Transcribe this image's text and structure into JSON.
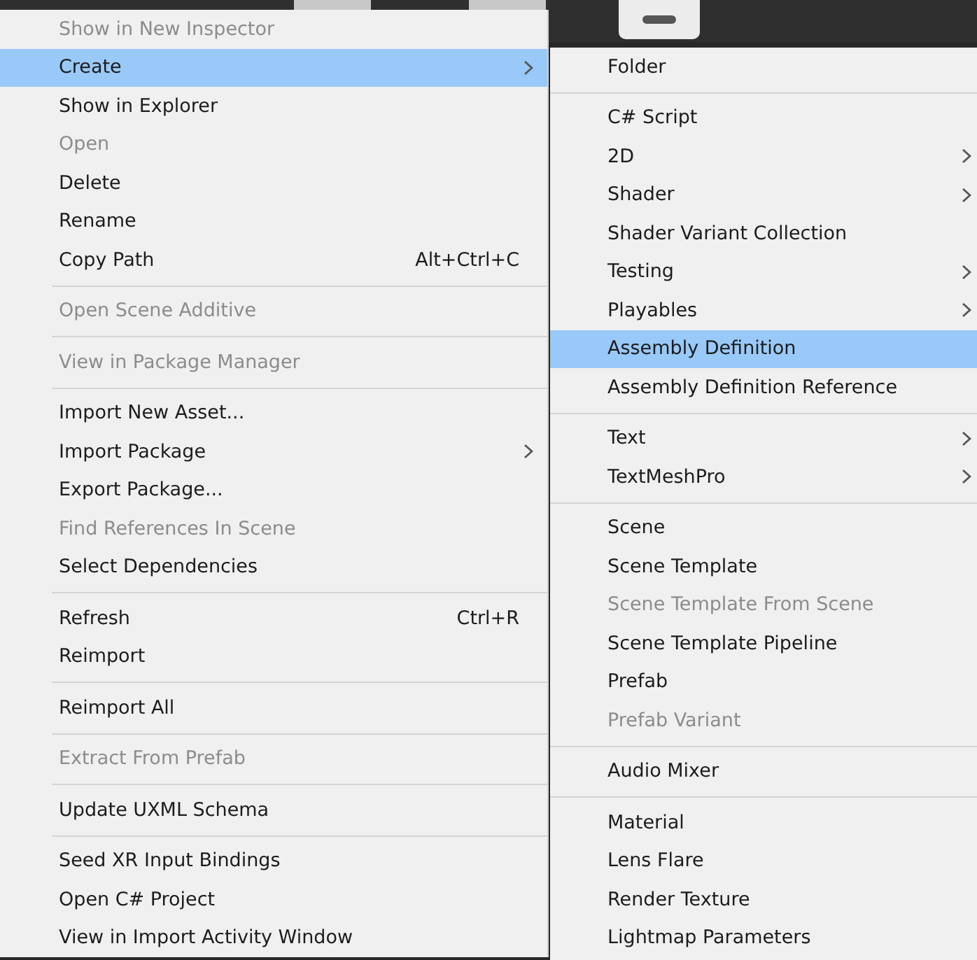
{
  "context_menu": {
    "items": [
      {
        "kind": "item",
        "label": "Show in New Inspector",
        "disabled": true,
        "selected": false,
        "submenu": false
      },
      {
        "kind": "item",
        "label": "Create",
        "disabled": false,
        "selected": true,
        "submenu": true
      },
      {
        "kind": "item",
        "label": "Show in Explorer",
        "disabled": false,
        "selected": false,
        "submenu": false
      },
      {
        "kind": "item",
        "label": "Open",
        "disabled": true,
        "selected": false,
        "submenu": false
      },
      {
        "kind": "item",
        "label": "Delete",
        "disabled": false,
        "selected": false,
        "submenu": false
      },
      {
        "kind": "item",
        "label": "Rename",
        "disabled": false,
        "selected": false,
        "submenu": false
      },
      {
        "kind": "item",
        "label": "Copy Path",
        "disabled": false,
        "selected": false,
        "submenu": false,
        "shortcut": "Alt+Ctrl+C"
      },
      {
        "kind": "separator"
      },
      {
        "kind": "item",
        "label": "Open Scene Additive",
        "disabled": true,
        "selected": false,
        "submenu": false
      },
      {
        "kind": "separator"
      },
      {
        "kind": "item",
        "label": "View in Package Manager",
        "disabled": true,
        "selected": false,
        "submenu": false
      },
      {
        "kind": "separator"
      },
      {
        "kind": "item",
        "label": "Import New Asset...",
        "disabled": false,
        "selected": false,
        "submenu": false
      },
      {
        "kind": "item",
        "label": "Import Package",
        "disabled": false,
        "selected": false,
        "submenu": true
      },
      {
        "kind": "item",
        "label": "Export Package...",
        "disabled": false,
        "selected": false,
        "submenu": false
      },
      {
        "kind": "item",
        "label": "Find References In Scene",
        "disabled": true,
        "selected": false,
        "submenu": false
      },
      {
        "kind": "item",
        "label": "Select Dependencies",
        "disabled": false,
        "selected": false,
        "submenu": false
      },
      {
        "kind": "separator"
      },
      {
        "kind": "item",
        "label": "Refresh",
        "disabled": false,
        "selected": false,
        "submenu": false,
        "shortcut": "Ctrl+R"
      },
      {
        "kind": "item",
        "label": "Reimport",
        "disabled": false,
        "selected": false,
        "submenu": false
      },
      {
        "kind": "separator"
      },
      {
        "kind": "item",
        "label": "Reimport All",
        "disabled": false,
        "selected": false,
        "submenu": false
      },
      {
        "kind": "separator"
      },
      {
        "kind": "item",
        "label": "Extract From Prefab",
        "disabled": true,
        "selected": false,
        "submenu": false
      },
      {
        "kind": "separator"
      },
      {
        "kind": "item",
        "label": "Update UXML Schema",
        "disabled": false,
        "selected": false,
        "submenu": false
      },
      {
        "kind": "separator"
      },
      {
        "kind": "item",
        "label": "Seed XR Input Bindings",
        "disabled": false,
        "selected": false,
        "submenu": false
      },
      {
        "kind": "item",
        "label": "Open C# Project",
        "disabled": false,
        "selected": false,
        "submenu": false
      },
      {
        "kind": "item",
        "label": "View in Import Activity Window",
        "disabled": false,
        "selected": false,
        "submenu": false
      }
    ]
  },
  "create_submenu": {
    "items": [
      {
        "kind": "item",
        "label": "Folder",
        "disabled": false,
        "selected": false,
        "submenu": false
      },
      {
        "kind": "separator"
      },
      {
        "kind": "item",
        "label": "C# Script",
        "disabled": false,
        "selected": false,
        "submenu": false
      },
      {
        "kind": "item",
        "label": "2D",
        "disabled": false,
        "selected": false,
        "submenu": true
      },
      {
        "kind": "item",
        "label": "Shader",
        "disabled": false,
        "selected": false,
        "submenu": true
      },
      {
        "kind": "item",
        "label": "Shader Variant Collection",
        "disabled": false,
        "selected": false,
        "submenu": false
      },
      {
        "kind": "item",
        "label": "Testing",
        "disabled": false,
        "selected": false,
        "submenu": true
      },
      {
        "kind": "item",
        "label": "Playables",
        "disabled": false,
        "selected": false,
        "submenu": true
      },
      {
        "kind": "item",
        "label": "Assembly Definition",
        "disabled": false,
        "selected": true,
        "submenu": false
      },
      {
        "kind": "item",
        "label": "Assembly Definition Reference",
        "disabled": false,
        "selected": false,
        "submenu": false
      },
      {
        "kind": "separator"
      },
      {
        "kind": "item",
        "label": "Text",
        "disabled": false,
        "selected": false,
        "submenu": true
      },
      {
        "kind": "item",
        "label": "TextMeshPro",
        "disabled": false,
        "selected": false,
        "submenu": true
      },
      {
        "kind": "separator"
      },
      {
        "kind": "item",
        "label": "Scene",
        "disabled": false,
        "selected": false,
        "submenu": false
      },
      {
        "kind": "item",
        "label": "Scene Template",
        "disabled": false,
        "selected": false,
        "submenu": false
      },
      {
        "kind": "item",
        "label": "Scene Template From Scene",
        "disabled": true,
        "selected": false,
        "submenu": false
      },
      {
        "kind": "item",
        "label": "Scene Template Pipeline",
        "disabled": false,
        "selected": false,
        "submenu": false
      },
      {
        "kind": "item",
        "label": "Prefab",
        "disabled": false,
        "selected": false,
        "submenu": false
      },
      {
        "kind": "item",
        "label": "Prefab Variant",
        "disabled": true,
        "selected": false,
        "submenu": false
      },
      {
        "kind": "separator"
      },
      {
        "kind": "item",
        "label": "Audio Mixer",
        "disabled": false,
        "selected": false,
        "submenu": false
      },
      {
        "kind": "separator"
      },
      {
        "kind": "item",
        "label": "Material",
        "disabled": false,
        "selected": false,
        "submenu": false
      },
      {
        "kind": "item",
        "label": "Lens Flare",
        "disabled": false,
        "selected": false,
        "submenu": false
      },
      {
        "kind": "item",
        "label": "Render Texture",
        "disabled": false,
        "selected": false,
        "submenu": false
      },
      {
        "kind": "item",
        "label": "Lightmap Parameters",
        "disabled": false,
        "selected": false,
        "submenu": false
      }
    ]
  }
}
